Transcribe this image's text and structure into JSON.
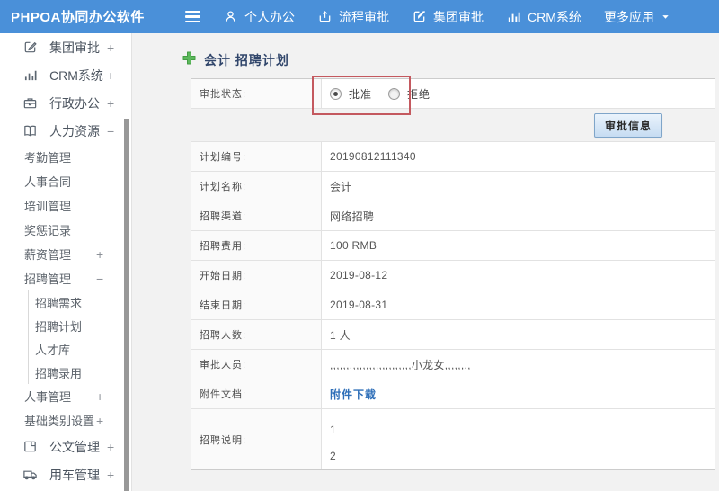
{
  "colors": {
    "topbar_bg": "#4a90d9",
    "highlight_box_border": "#c4595f",
    "link": "#2f6fb8",
    "title_text": "#31466b",
    "plus_icon_green": "#5cb85c",
    "button_bg": "#c6dcf2"
  },
  "topbar": {
    "logo": "PHPOA协同办公软件",
    "nav": [
      {
        "icon": "user-icon",
        "label": "个人办公"
      },
      {
        "icon": "flow-upload-icon",
        "label": "流程审批"
      },
      {
        "icon": "edit-square-icon",
        "label": "集团审批"
      },
      {
        "icon": "bar-chart-icon",
        "label": "CRM系统"
      },
      {
        "icon": "caret-down-icon",
        "label": "更多应用"
      }
    ]
  },
  "sidebar": {
    "items": [
      {
        "label": "集团审批",
        "sign": "+",
        "icon": "edit-square-icon",
        "level": 0
      },
      {
        "label": "CRM系统",
        "sign": "+",
        "icon": "bar-chart-icon",
        "level": 0
      },
      {
        "label": "行政办公",
        "sign": "+",
        "icon": "briefcase-icon",
        "level": 0
      },
      {
        "label": "人力资源",
        "sign": "−",
        "icon": "book-icon",
        "level": 0
      },
      {
        "label": "考勤管理",
        "level": 1
      },
      {
        "label": "人事合同",
        "level": 1
      },
      {
        "label": "培训管理",
        "level": 1
      },
      {
        "label": "奖惩记录",
        "level": 1
      },
      {
        "label": "薪资管理",
        "sign": "+",
        "level": 1
      },
      {
        "label": "招聘管理",
        "sign": "−",
        "level": 1
      },
      {
        "label": "招聘需求",
        "level": 2
      },
      {
        "label": "招聘计划",
        "level": 2
      },
      {
        "label": "人才库",
        "level": 2
      },
      {
        "label": "招聘录用",
        "level": 2
      },
      {
        "label": "人事管理",
        "sign": "+",
        "level": 1
      },
      {
        "label": "基础类别设置",
        "sign": "+",
        "level": 1
      },
      {
        "label": "公文管理",
        "sign": "+",
        "icon": "document-icon",
        "level": 0
      },
      {
        "label": "用车管理",
        "sign": "+",
        "icon": "truck-icon",
        "level": 0
      }
    ]
  },
  "main": {
    "title": "会计 招聘计划",
    "form": {
      "status_label": "审批状态:",
      "radio_approve": "批准",
      "radio_reject": "拒绝",
      "approve_selected": true,
      "button_label": "审批信息",
      "rows": [
        {
          "label": "计划编号:",
          "value": "20190812111340"
        },
        {
          "label": "计划名称:",
          "value": "会计"
        },
        {
          "label": "招聘渠道:",
          "value": "网络招聘"
        },
        {
          "label": "招聘费用:",
          "value": "100 RMB"
        },
        {
          "label": "开始日期:",
          "value": "2019-08-12"
        },
        {
          "label": "结束日期:",
          "value": "2019-08-31"
        },
        {
          "label": "招聘人数:",
          "value": "1 人"
        },
        {
          "label": "审批人员:",
          "value": ",,,,,,,,,,,,,,,,,,,,,,,,,小龙女,,,,,,,,"
        }
      ],
      "attachment": {
        "label": "附件文档:",
        "link": "附件下载"
      },
      "description": {
        "label": "招聘说明:",
        "lines": [
          "1",
          "2"
        ]
      }
    }
  }
}
